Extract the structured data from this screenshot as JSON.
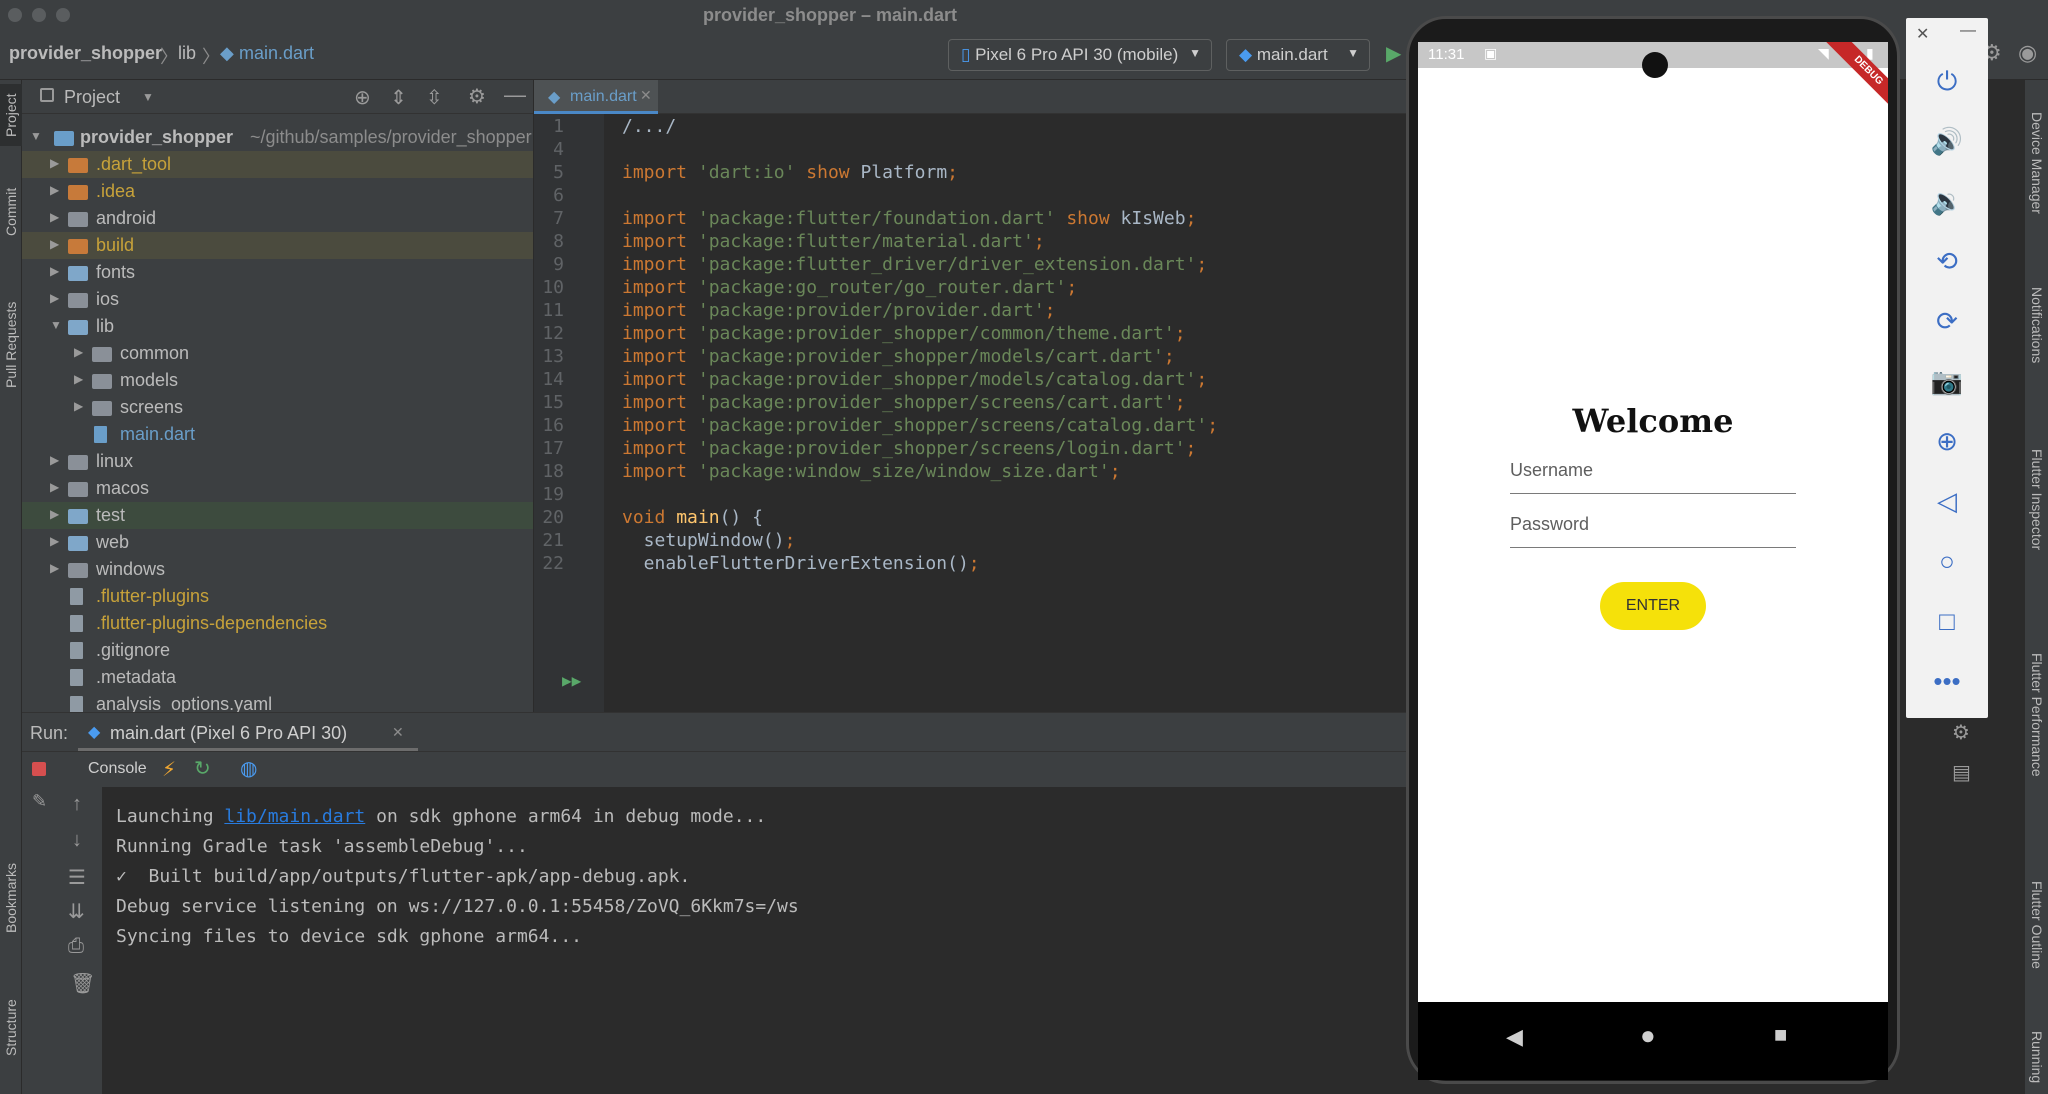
{
  "window": {
    "title": "provider_shopper – main.dart"
  },
  "navbar": {
    "breadcrumb": [
      "provider_shopper",
      "lib",
      "main.dart"
    ],
    "device_selector": "Pixel 6 Pro API 30 (mobile)",
    "run_config": "main.dart"
  },
  "left_strip": {
    "tabs": [
      "Project",
      "Commit",
      "Pull Requests",
      "Bookmarks",
      "Structure"
    ]
  },
  "project": {
    "header": "Project",
    "root": "provider_shopper",
    "root_path": "~/github/samples/provider_shopper",
    "tree": [
      {
        "label": ".dart_tool",
        "kind": "folder",
        "color": "#c7a23a"
      },
      {
        "label": ".idea",
        "kind": "folder",
        "color": "#c7a23a"
      },
      {
        "label": "android",
        "kind": "folder",
        "color": "#bbbbbb"
      },
      {
        "label": "build",
        "kind": "folder",
        "color": "#c7a23a"
      },
      {
        "label": "fonts",
        "kind": "folder",
        "color": "#bbbbbb"
      },
      {
        "label": "ios",
        "kind": "folder",
        "color": "#bbbbbb"
      },
      {
        "label": "lib",
        "kind": "folder",
        "color": "#bbbbbb"
      },
      {
        "label": "common",
        "kind": "folder",
        "color": "#bbbbbb"
      },
      {
        "label": "models",
        "kind": "folder",
        "color": "#bbbbbb"
      },
      {
        "label": "screens",
        "kind": "folder",
        "color": "#bbbbbb"
      },
      {
        "label": "main.dart",
        "kind": "file",
        "color": "#6a9ec9"
      },
      {
        "label": "linux",
        "kind": "folder",
        "color": "#bbbbbb"
      },
      {
        "label": "macos",
        "kind": "folder",
        "color": "#bbbbbb"
      },
      {
        "label": "test",
        "kind": "folder",
        "color": "#bbbbbb"
      },
      {
        "label": "web",
        "kind": "folder",
        "color": "#bbbbbb"
      },
      {
        "label": "windows",
        "kind": "folder",
        "color": "#bbbbbb"
      },
      {
        "label": ".flutter-plugins",
        "kind": "file",
        "color": "#c7a23a"
      },
      {
        "label": ".flutter-plugins-dependencies",
        "kind": "file",
        "color": "#c7a23a"
      },
      {
        "label": ".gitignore",
        "kind": "file",
        "color": "#bbbbbb"
      },
      {
        "label": ".metadata",
        "kind": "file",
        "color": "#bbbbbb"
      },
      {
        "label": "analysis_options.yaml",
        "kind": "file",
        "color": "#bbbbbb"
      }
    ]
  },
  "editor": {
    "tab": "main.dart",
    "lines": [
      {
        "n": "1",
        "text": "/.../"
      },
      {
        "n": "4",
        "text": ""
      },
      {
        "n": "5",
        "text": "import 'dart:io' show Platform;"
      },
      {
        "n": "6",
        "text": ""
      },
      {
        "n": "7",
        "text": "import 'package:flutter/foundation.dart' show kIsWeb;"
      },
      {
        "n": "8",
        "text": "import 'package:flutter/material.dart';"
      },
      {
        "n": "9",
        "text": "import 'package:flutter_driver/driver_extension.dart';"
      },
      {
        "n": "10",
        "text": "import 'package:go_router/go_router.dart';"
      },
      {
        "n": "11",
        "text": "import 'package:provider/provider.dart';"
      },
      {
        "n": "12",
        "text": "import 'package:provider_shopper/common/theme.dart';"
      },
      {
        "n": "13",
        "text": "import 'package:provider_shopper/models/cart.dart';"
      },
      {
        "n": "14",
        "text": "import 'package:provider_shopper/models/catalog.dart';"
      },
      {
        "n": "15",
        "text": "import 'package:provider_shopper/screens/cart.dart';"
      },
      {
        "n": "16",
        "text": "import 'package:provider_shopper/screens/catalog.dart';"
      },
      {
        "n": "17",
        "text": "import 'package:provider_shopper/screens/login.dart';"
      },
      {
        "n": "18",
        "text": "import 'package:window_size/window_size.dart';"
      },
      {
        "n": "19",
        "text": ""
      },
      {
        "n": "20",
        "text": "void main() {"
      },
      {
        "n": "21",
        "text": "  setupWindow();"
      },
      {
        "n": "22",
        "text": "  enableFlutterDriverExtension();"
      }
    ]
  },
  "run": {
    "label": "Run:",
    "tab": "main.dart (Pixel 6 Pro API 30)",
    "console_tab": "Console",
    "output": [
      {
        "prefix": "Launching ",
        "link": "lib/main.dart",
        "suffix": " on sdk gphone arm64 in debug mode..."
      },
      {
        "prefix": "Running Gradle task 'assembleDebug'...",
        "link": "",
        "suffix": ""
      },
      {
        "prefix": "✓  Built build/app/outputs/flutter-apk/app-debug.apk.",
        "link": "",
        "suffix": ""
      },
      {
        "prefix": "Debug service listening on ws://127.0.0.1:55458/ZoVQ_6Kkm7s=/ws",
        "link": "",
        "suffix": ""
      },
      {
        "prefix": "Syncing files to device sdk gphone arm64...",
        "link": "",
        "suffix": ""
      }
    ]
  },
  "device": {
    "time": "11:31",
    "welcome": "Welcome",
    "username_placeholder": "Username",
    "password_placeholder": "Password",
    "enter_label": "ENTER",
    "debug_ribbon": "DEBUG"
  },
  "right_strip": {
    "tabs": [
      "Device Manager",
      "Notifications",
      "Flutter Inspector",
      "Flutter Performance",
      "Flutter Outline",
      "Running Devices"
    ]
  },
  "colors": {
    "ide_bg": "#2b2b2b",
    "panel_bg": "#3c3f41",
    "accent_yellow": "#f5e10a",
    "link_blue": "#287bde"
  }
}
